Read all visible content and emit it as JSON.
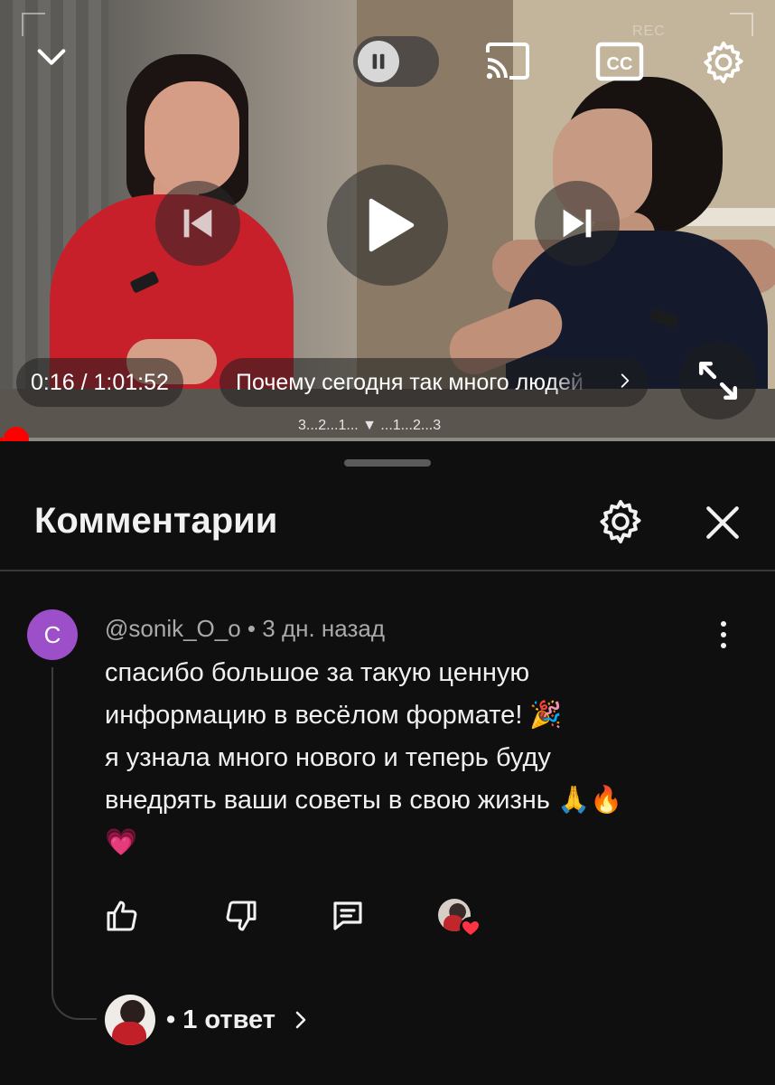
{
  "player": {
    "time_display": "0:16 / 1:01:52",
    "chapter_title": "Почему сегодня так много людей",
    "progress_fraction": 0.0043,
    "overlay_rec": "REC",
    "overlay_countdown": "3...2...1... ▼ ...1...2...3",
    "accent_color": "#ff0000"
  },
  "comments_panel": {
    "title": "Комментарии"
  },
  "comment": {
    "avatar_letter": "С",
    "avatar_color": "#9c4fc9",
    "author": "@sonik_O_o",
    "separator": " • ",
    "age": "3 дн. назад",
    "lines": [
      "спасибо большое за такую ценную",
      "информацию в весёлом формате! 🎉",
      "я узнала много нового и теперь буду",
      "внедрять ваши советы в свою жизнь 🙏🔥",
      "💗"
    ],
    "reply_label": "• 1 ответ"
  },
  "icons": {
    "collapse": "chevron-down-icon",
    "pause": "pause-icon",
    "cast": "cast-icon",
    "captions": "cc-icon",
    "settings": "gear-icon",
    "previous": "skip-previous-icon",
    "play": "play-icon",
    "next": "skip-next-icon",
    "fullscreen": "fullscreen-icon",
    "close": "close-icon",
    "more": "more-vertical-icon",
    "like": "thumbs-up-icon",
    "dislike": "thumbs-down-icon",
    "reply": "reply-icon",
    "creator_heart": "creator-heart-icon"
  }
}
